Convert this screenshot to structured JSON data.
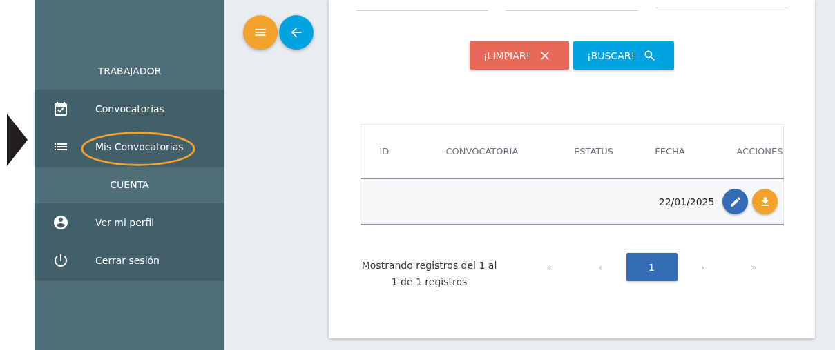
{
  "pointer": {
    "kind": "triangle"
  },
  "sidebar": {
    "sections": [
      {
        "title": "TRABAJADOR",
        "items": [
          {
            "label": "Convocatorias",
            "kind": "calendar-check",
            "circled": false
          },
          {
            "label": "Mis Convocatorias",
            "kind": "list",
            "circled": true
          }
        ]
      },
      {
        "title": "CUENTA",
        "items": [
          {
            "label": "Ver mi perfil",
            "kind": "account",
            "circled": false
          },
          {
            "label": "Cerrar sesión",
            "kind": "power",
            "circled": false
          }
        ]
      }
    ]
  },
  "fab_buttons": [
    {
      "kind": "menu"
    },
    {
      "kind": "back"
    }
  ],
  "filter_fields": [
    {
      "kind": "underline"
    },
    {
      "kind": "underline"
    },
    {
      "kind": "underline"
    }
  ],
  "buttons": [
    {
      "label": "¡LIMPIAR!",
      "kind": "clear"
    },
    {
      "label": "¡BUSCAR!",
      "kind": "search"
    }
  ],
  "table": {
    "columns": [
      "ID",
      "CONVOCATORIA",
      "ESTATUS",
      "FECHA",
      "ACCIONES"
    ],
    "rows": [
      {
        "fecha": "22/01/2025",
        "actions": [
          {
            "kind": "edit"
          },
          {
            "kind": "download"
          }
        ]
      }
    ]
  },
  "footer": {
    "summary": "Mostrando registros del 1 al 1 de 1 registros",
    "pages": [
      {
        "label": "«",
        "selected": false
      },
      {
        "label": "‹",
        "selected": false
      },
      {
        "label": "1",
        "selected": true
      },
      {
        "label": "›",
        "selected": false
      },
      {
        "label": "»",
        "selected": false
      }
    ]
  }
}
